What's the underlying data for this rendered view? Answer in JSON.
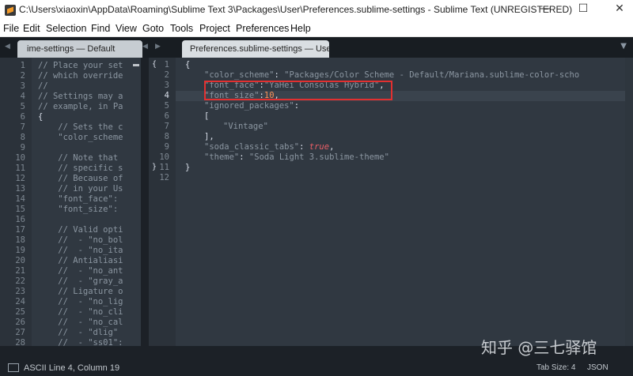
{
  "window": {
    "title": "C:\\Users\\xiaoxin\\AppData\\Roaming\\Sublime Text 3\\Packages\\User\\Preferences.sublime-settings - Sublime Text (UNREGISTERED)",
    "minimize": "—",
    "maximize": "☐",
    "close": "✕"
  },
  "menu": [
    "File",
    "Edit",
    "Selection",
    "Find",
    "View",
    "Goto",
    "Tools",
    "Project",
    "Preferences",
    "Help"
  ],
  "tabs": {
    "left_label": "ime-settings — Default",
    "right_label": "Preferences.sublime-settings — User"
  },
  "left_pane": {
    "line_numbers": [
      "1",
      "2",
      "3",
      "4",
      "5",
      "6",
      "7",
      "8",
      "9",
      "10",
      "11",
      "12",
      "13",
      "14",
      "15",
      "16",
      "17",
      "18",
      "19",
      "20",
      "21",
      "22",
      "23",
      "24",
      "25",
      "26",
      "27",
      "28"
    ],
    "lines": [
      "// Place your set",
      "// which override",
      "//",
      "// Settings may a",
      "// example, in Pa",
      "{",
      "    // Sets the c",
      "    \"color_scheme",
      "",
      "    // Note that",
      "    // specific s",
      "    // Because of",
      "    // in your Us",
      "    \"font_face\":",
      "    \"font_size\":",
      "",
      "    // Valid opti",
      "    //  - \"no_bol",
      "    //  - \"no_ita",
      "    // Antialiasi",
      "    //  - \"no_ant",
      "    //  - \"gray_a",
      "    // Ligature o",
      "    //  - \"no_lig",
      "    //  - \"no_cli",
      "    //  - \"no_cal",
      "    //  - \"dlig\"",
      "    //  - \"ss01\":"
    ]
  },
  "right_pane": {
    "line_numbers": [
      "1",
      "2",
      "3",
      "4",
      "5",
      "6",
      "7",
      "8",
      "9",
      "10",
      "11",
      "12"
    ],
    "code": {
      "l1": "{",
      "l2_key": "\"color_scheme\"",
      "l2_colon": ": ",
      "l2_val": "\"Packages/Color Scheme - Default/Mariana.sublime-color-scho",
      "l3_key": "\"font_face\"",
      "l3_colon": ":",
      "l3_val": "\"YaHei Consolas Hybrid\"",
      "l3_comma": ",",
      "l4_key": "\"font_size\"",
      "l4_colon": ":",
      "l4_val": "10",
      "l4_comma": ",",
      "l5_key": "\"ignored_packages\"",
      "l5_colon": ":",
      "l6": "[",
      "l7_val": "\"Vintage\"",
      "l8": "],",
      "l9_key": "\"soda_classic_tabs\"",
      "l9_colon": ": ",
      "l9_val": "true",
      "l9_comma": ",",
      "l10_key": "\"theme\"",
      "l10_colon": ": ",
      "l10_val": "\"Soda Light 3.sublime-theme\"",
      "l11": "}"
    }
  },
  "status": {
    "left": "ASCII Line 4, Column 19",
    "tab_size": "Tab Size: 4",
    "syntax": "JSON"
  },
  "watermark": "知乎 @三七驿馆"
}
